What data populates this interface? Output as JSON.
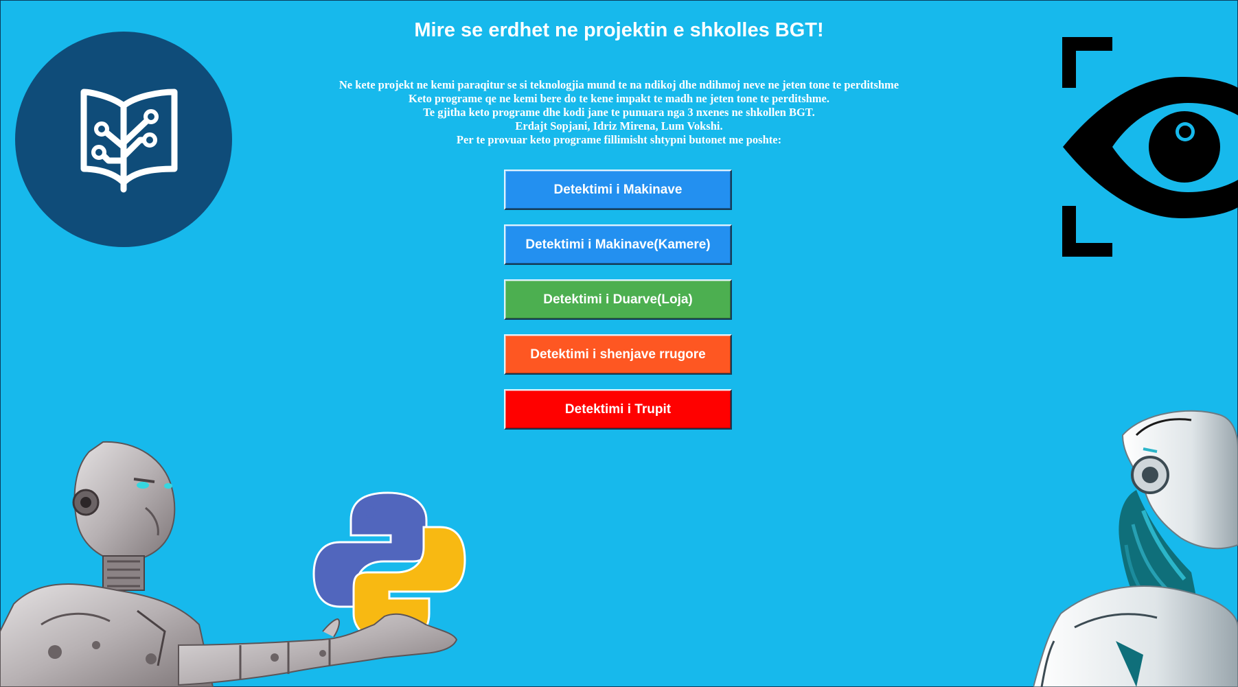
{
  "header": {
    "title": "Mire se erdhet ne projektin e shkolles BGT!"
  },
  "intro": {
    "lines": [
      "Ne kete projekt ne kemi paraqitur se si teknologjia mund te na ndikoj dhe ndihmoj neve ne jeten tone te perditshme",
      "Keto programe qe ne kemi bere do te kene impakt te madh ne jeten tone te perditshme.",
      "Te gjitha keto programe dhe kodi jane te punuara nga 3 nxenes ne shkollen BGT.",
      "Erdajt Sopjani, Idriz Mirena, Lum Vokshi.",
      "Per te provuar keto programe fillimisht shtypni butonet me poshte:"
    ]
  },
  "buttons": [
    {
      "label": "Detektimi i Makinave",
      "color": "#2390f0"
    },
    {
      "label": "Detektimi i Makinave(Kamere)",
      "color": "#2390f0"
    },
    {
      "label": "Detektimi i Duarve(Loja)",
      "color": "#4caf50"
    },
    {
      "label": "Detektimi i shenjave rrugore",
      "color": "#fe5722"
    },
    {
      "label": "Detektimi i Trupit",
      "color": "#ff0100"
    }
  ],
  "icons": {
    "top_left": "book-circuit-logo-icon",
    "top_right": "eye-scan-icon",
    "bottom_center": "python-logo-icon",
    "bottom_left": "humanoid-robot-illustration",
    "bottom_right": "white-robot-illustration"
  },
  "colors": {
    "background": "#17b9ec",
    "logo_circle": "#0f4c79",
    "text": "#ffffff"
  }
}
